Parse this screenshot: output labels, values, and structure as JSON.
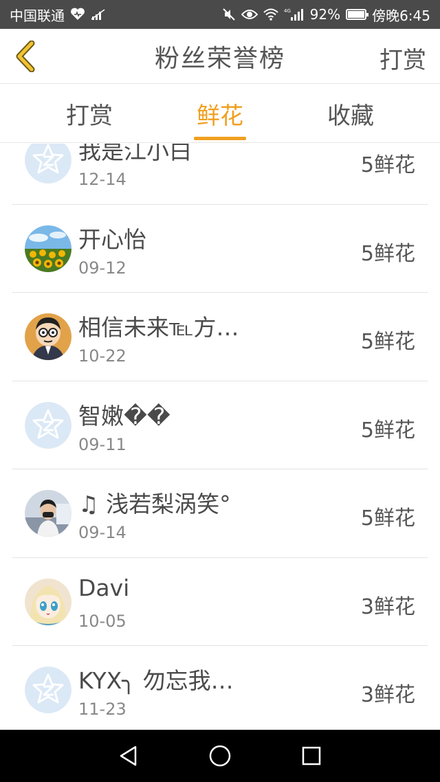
{
  "status_bar": {
    "carrier": "中国联通",
    "battery": "92%",
    "battery_level": 0.92,
    "time": "傍晚6:45",
    "network": "4G"
  },
  "header": {
    "title": "粉丝荣誉榜",
    "action": "打赏"
  },
  "tabs": [
    {
      "label": "打赏",
      "active": false
    },
    {
      "label": "鲜花",
      "active": true
    },
    {
      "label": "收藏",
      "active": false
    }
  ],
  "list": [
    {
      "name": "我是江小白",
      "date": "12-14",
      "amount": "5鲜花",
      "avatar": "default-avatar-icon"
    },
    {
      "name": "开心怡",
      "date": "09-12",
      "amount": "5鲜花",
      "avatar": "sunflower-photo"
    },
    {
      "name": "相信未来℡方…",
      "date": "10-22",
      "amount": "5鲜花",
      "avatar": "cartoon-boy-photo"
    },
    {
      "name": "智嫩��",
      "date": "09-11",
      "amount": "5鲜花",
      "avatar": "default-avatar-icon"
    },
    {
      "name": "♫ 浅若梨涡笑°",
      "date": "09-14",
      "amount": "5鲜花",
      "avatar": "person-photo"
    },
    {
      "name": "Davi",
      "date": "10-05",
      "amount": "3鲜花",
      "avatar": "anime-girl-photo"
    },
    {
      "name": "KYX╮ 勿忘我…",
      "date": "11-23",
      "amount": "3鲜花",
      "avatar": "default-avatar-icon"
    }
  ],
  "colors": {
    "accent": "#f0a020",
    "status_bar": "#4a4a4a",
    "default_avatar": "#dbe8f6"
  }
}
